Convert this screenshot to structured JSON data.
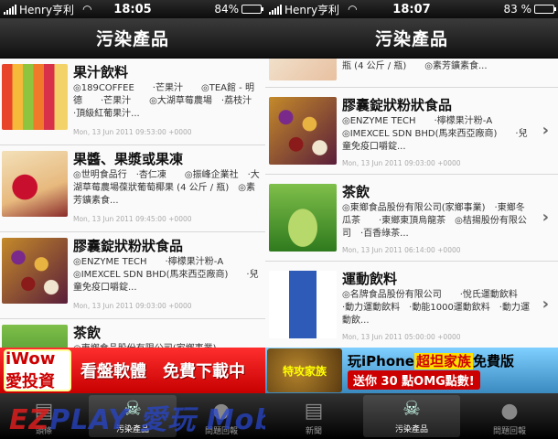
{
  "left": {
    "status": {
      "carrier": "Henry亨利",
      "time": "18:05",
      "battery": "84%",
      "battery_level": 0.84
    },
    "nav_title": "污染產品",
    "rows": [
      {
        "title": "果汁飲料",
        "desc": "◎189COFFEE　　·芒果汁　　◎TEA館 - 明德　　·芒果汁　　◎大湖草莓農場　·荔枝汁　　·頂級紅葡果汁...",
        "date": "Mon, 13 Jun 2011 09:53:00 +0000",
        "thumb": "juice"
      },
      {
        "title": "果醬、果漿或果凍",
        "desc": "◎世明食品行　·杏仁凍　　◎振峰企業社　·大湖草莓農場葆狀葡萄椰果 (4 公斤 / 瓶)　◎素芳鑛素食...",
        "date": "Mon, 13 Jun 2011 09:45:00 +0000",
        "thumb": "jam"
      },
      {
        "title": "膠囊錠狀粉狀食品",
        "desc": "◎ENZYME TECH　　·檸檬果汁粉-A　　◎IMEXCEL SDN BHD(馬來西亞廠商)　　·兒童免疫口嚼錠...",
        "date": "Mon, 13 Jun 2011 09:03:00 +0000",
        "thumb": "capsule"
      },
      {
        "title": "茶飲",
        "desc": "◎東鄉食品股份有限公司(家鄉事業)",
        "date": "",
        "thumb": "tea"
      }
    ],
    "ad": {
      "logo": "iWow 愛投資",
      "text": "看盤軟體　免費下載中"
    },
    "tabs": [
      {
        "label": "頭條",
        "icon": "newspaper-icon"
      },
      {
        "label": "污染產品",
        "icon": "skull-icon"
      },
      {
        "label": "問題回報",
        "icon": "speech-bubble-icon"
      }
    ],
    "active_tab": 1,
    "watermark": {
      "ez": "EZ",
      "rest": "PLAY 愛玩 Mobi"
    }
  },
  "right": {
    "status": {
      "carrier": "Henry亨利",
      "time": "18:07",
      "battery": "83 %",
      "battery_level": 0.83
    },
    "nav_title": "污染產品",
    "partial_row": {
      "desc": "瓶 (4 公斤 / 瓶)　　◎素芳鑛素食..."
    },
    "rows": [
      {
        "title": "膠囊錠狀粉狀食品",
        "desc": "◎ENZYME TECH　　·檸檬果汁粉-A　　◎IMEXCEL SDN BHD(馬來西亞廠商)　　·兒童免疫口嚼錠...",
        "date": "Mon, 13 Jun 2011 09:03:00 +0000",
        "thumb": "capsule"
      },
      {
        "title": "茶飲",
        "desc": "◎東鄉食品股份有限公司(家鄉事業)　·東鄉冬瓜茶　　·東鄉東頂烏龍茶　◎桔揚股份有限公司　·百香綠茶...",
        "date": "Mon, 13 Jun 2011 06:14:00 +0000",
        "thumb": "tea"
      },
      {
        "title": "運動飲料",
        "desc": "◎名牌食品股份有限公司　　·悅氏運動飲料　　·動力運動飲料　·動能1000運動飲料　·動力運動飲...",
        "date": "Mon, 13 Jun 2011 05:00:00 +0000",
        "thumb": "bottle"
      }
    ],
    "ad": {
      "art": "特攻家族",
      "line1_a": "玩iPhone",
      "line1_b": "超坦家族",
      "line1_c": "免費版",
      "line2": "送你 30 點OMG點數!"
    },
    "tabs": [
      {
        "label": "新聞",
        "icon": "newspaper-icon"
      },
      {
        "label": "污染產品",
        "icon": "skull-icon"
      },
      {
        "label": "問題回報",
        "icon": "speech-bubble-icon"
      }
    ],
    "active_tab": 1
  }
}
